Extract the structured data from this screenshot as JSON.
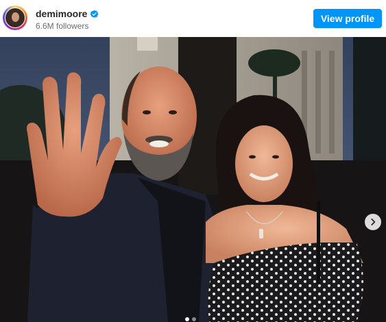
{
  "post": {
    "username": "demimoore",
    "followers": "6.6M followers",
    "view_profile_label": "View profile",
    "verified_icon": "verified-badge-icon",
    "accent_color": "#0095f6"
  },
  "carousel": {
    "next_icon": "chevron-right-icon",
    "slide_count": 2,
    "active_slide": 1
  }
}
